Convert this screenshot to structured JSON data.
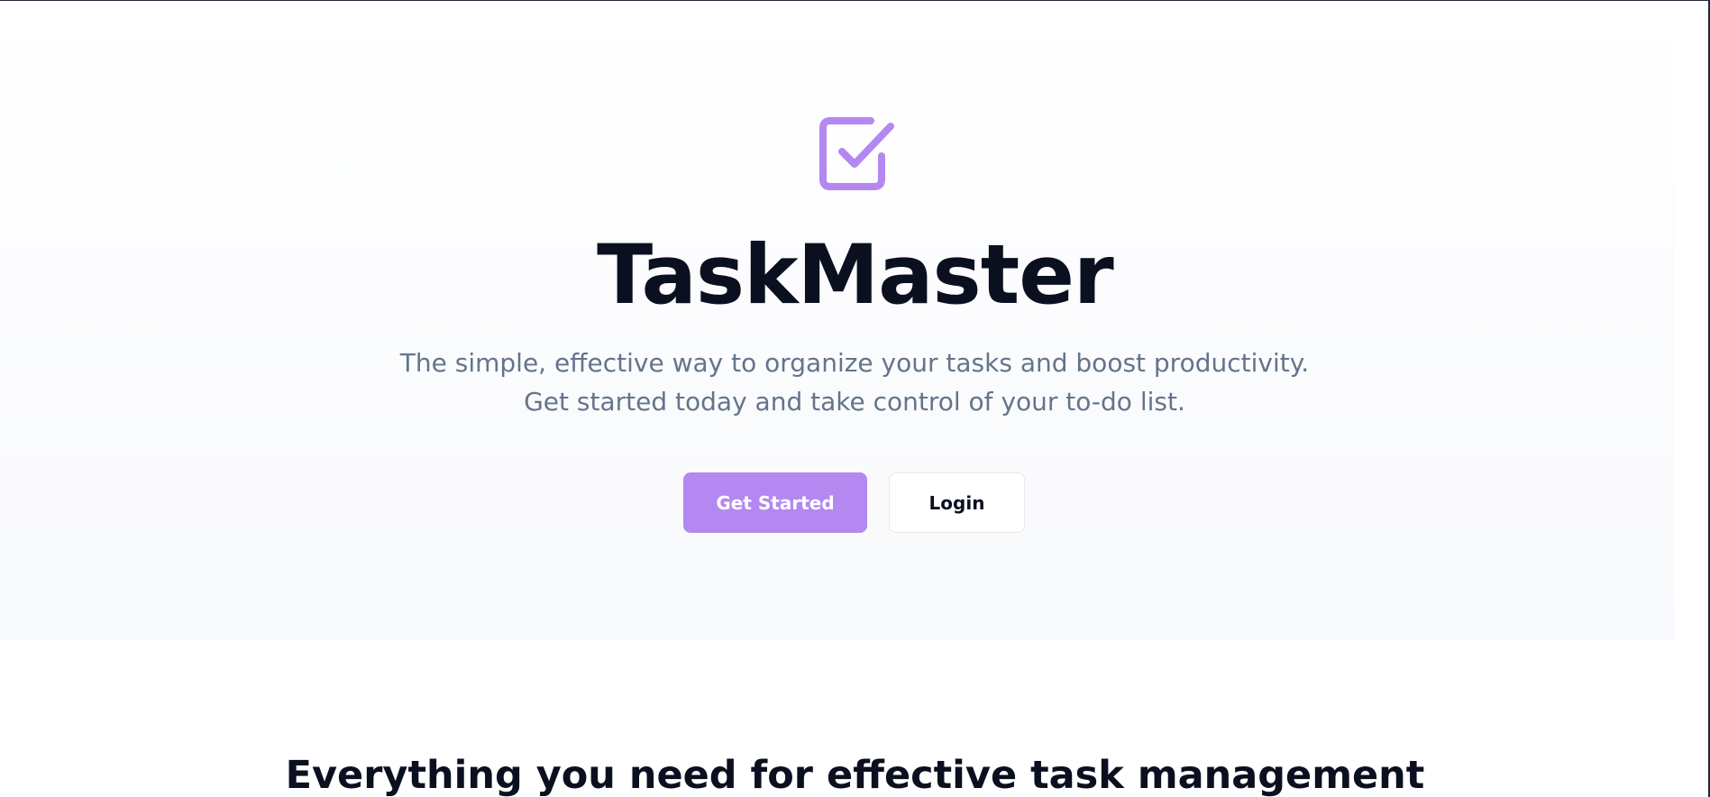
{
  "hero": {
    "logo_icon": "checkbox-checked-icon",
    "title": "TaskMaster",
    "subtitle": "The simple, effective way to organize your tasks and boost productivity. Get started today and take control of your to-do list.",
    "primary_button_label": "Get Started",
    "secondary_button_label": "Login"
  },
  "features": {
    "heading": "Everything you need for effective task management"
  },
  "colors": {
    "accent": "#b388f0",
    "title_text": "#0b1020",
    "subtitle_text": "#64748b",
    "hero_background_bottom": "#f8f9fc"
  }
}
